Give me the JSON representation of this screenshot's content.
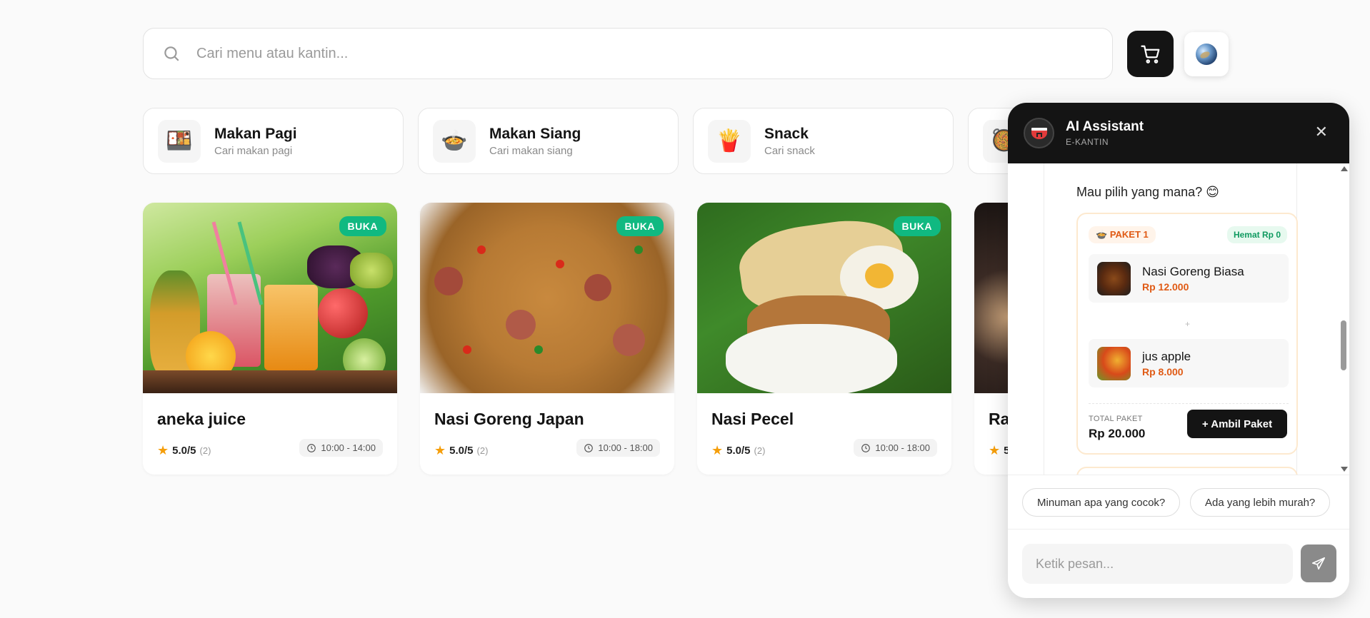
{
  "search": {
    "placeholder": "Cari menu atau kantin..."
  },
  "header": {
    "cart_icon": "cart-icon",
    "avatar_icon": "globe-avatar"
  },
  "categories": [
    {
      "title": "Makan Pagi",
      "subtitle": "Cari makan pagi",
      "icon": "breakfast-icon"
    },
    {
      "title": "Makan Siang",
      "subtitle": "Cari makan siang",
      "icon": "lunch-icon"
    },
    {
      "title": "Snack",
      "subtitle": "Cari snack",
      "icon": "snack-icon"
    }
  ],
  "menus": [
    {
      "name": "aneka juice",
      "badge": "BUKA",
      "rating": "5.0/5",
      "count": "(2)",
      "hours": "10:00 - 14:00"
    },
    {
      "name": "Nasi Goreng Japan",
      "badge": "BUKA",
      "rating": "5.0/5",
      "count": "(2)",
      "hours": "10:00 - 18:00"
    },
    {
      "name": "Nasi Pecel",
      "badge": "BUKA",
      "rating": "5.0/5",
      "count": "(2)",
      "hours": "10:00 - 18:00"
    },
    {
      "name": "Ra",
      "rating": "5"
    }
  ],
  "chat": {
    "title": "AI Assistant",
    "subtitle": "E-KANTIN",
    "close": "✕",
    "question": "Mau pilih yang mana? 😊",
    "package": {
      "label": "PAKET 1",
      "savings": "Hemat Rp 0",
      "items": [
        {
          "name": "Nasi Goreng Biasa",
          "price": "Rp 12.000"
        },
        {
          "name": "jus apple",
          "price": "Rp 8.000"
        }
      ],
      "plus": "+",
      "total_label": "TOTAL PAKET",
      "total_value": "Rp 20.000",
      "take_label": "+ Ambil Paket"
    },
    "suggestions": [
      "Minuman apa yang cocok?",
      "Ada yang lebih murah?"
    ],
    "input_placeholder": "Ketik pesan..."
  },
  "colors": {
    "accent": "#141414",
    "open_badge": "#10b981",
    "price": "#e05a14"
  }
}
